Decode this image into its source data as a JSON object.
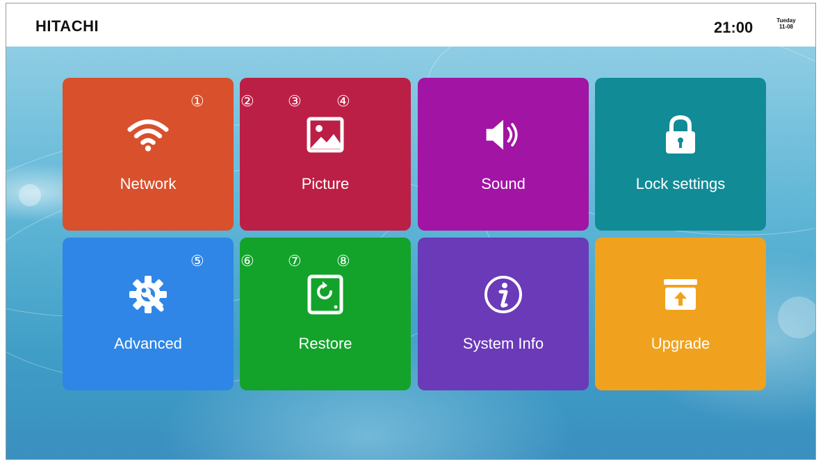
{
  "brand": "HITACHI",
  "time": "21:00",
  "date": {
    "day": "Tueday",
    "date": "11-08"
  },
  "tiles": [
    {
      "label": "Network",
      "icon": "wifi-icon",
      "color": "#d9502c"
    },
    {
      "label": "Picture",
      "icon": "picture-icon",
      "color": "#bc1f45"
    },
    {
      "label": "Sound",
      "icon": "speaker-icon",
      "color": "#a114a4"
    },
    {
      "label": "Lock settings",
      "icon": "lock-icon",
      "color": "#118b96"
    },
    {
      "label": "Advanced",
      "icon": "gear-wrench-icon",
      "color": "#2f86e6"
    },
    {
      "label": "Restore",
      "icon": "restore-icon",
      "color": "#13a32b"
    },
    {
      "label": "System Info",
      "icon": "info-icon",
      "color": "#6a3ab8"
    },
    {
      "label": "Upgrade",
      "icon": "upgrade-icon",
      "color": "#f0a21e"
    }
  ],
  "annotations": [
    "①",
    "②",
    "③",
    "④",
    "⑤",
    "⑥",
    "⑦",
    "⑧"
  ]
}
